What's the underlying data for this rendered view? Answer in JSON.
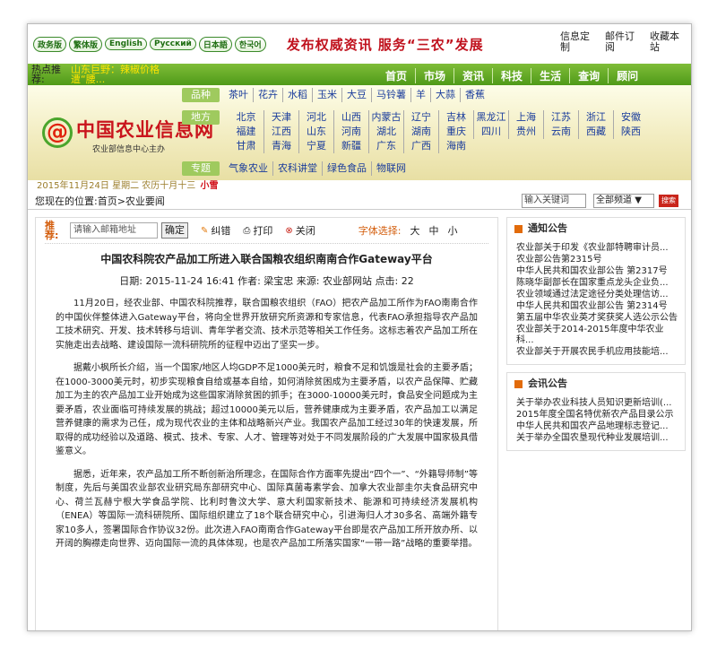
{
  "top": {
    "langs": [
      "政务版",
      "繁体版",
      "English",
      "Русский",
      "日本語",
      "한국어"
    ],
    "slogan": "发布权威资讯    服务“三农”发展",
    "links": [
      "信息定制",
      "邮件订阅",
      "收藏本站"
    ]
  },
  "nav": {
    "ticker_label": "热点推荐:",
    "ticker_text": "山东巨野：辣椒价格遭“腰...",
    "items": [
      "首页",
      "市场",
      "资讯",
      "科技",
      "生活",
      "查询",
      "顾问"
    ]
  },
  "header": {
    "logo_mark": "@",
    "logo_title": "中国农业信息网",
    "logo_sub": "农业部信息中心主办",
    "cats": [
      {
        "label": "品种",
        "items": [
          "茶叶",
          "花卉",
          "水稻",
          "玉米",
          "大豆",
          "马铃薯",
          "羊",
          "大蒜",
          "香蕉"
        ]
      },
      {
        "label": "地方",
        "items": [
          "北京",
          "天津",
          "河北",
          "山西",
          "内蒙古",
          "辽宁",
          "吉林",
          "黑龙江",
          "上海",
          "江苏",
          "浙江",
          "安徽",
          "福建",
          "江西",
          "山东",
          "河南",
          "湖北",
          "湖南",
          "重庆",
          "四川",
          "贵州",
          "云南",
          "西藏",
          "陕西",
          "甘肃",
          "青海",
          "宁夏",
          "新疆",
          "广东",
          "广西",
          "海南"
        ]
      },
      {
        "label": "专题",
        "items": [
          "气象农业",
          "农科讲堂",
          "绿色食品",
          "物联网"
        ]
      }
    ]
  },
  "datebar": {
    "text": "2015年11月24日  星期二  农历十月十三",
    "festival": "小雪"
  },
  "location": {
    "text": "您现在的位置:首页>农业要闻",
    "search_placeholder": "输入关键词",
    "channel": "全部频道",
    "go": "搜索"
  },
  "article": {
    "recommend_label": "推荐:",
    "email_placeholder": "请输入邮箱地址",
    "confirm": "确定",
    "tools": [
      "纠错",
      "打印",
      "关闭"
    ],
    "font_label": "字体选择:",
    "font_sizes": [
      "大",
      "中",
      "小"
    ],
    "title": "中国农科院农产品加工所进入联合国粮农组织南南合作Gateway平台",
    "meta": "日期: 2015-11-24 16:41  作者: 梁宝忠  来源: 农业部网站  点击: 22",
    "paragraphs": [
      "11月20日，经农业部、中国农科院推荐，联合国粮农组织（FAO）把农产品加工所作为FAO南南合作的中国伙伴整体进入Gateway平台，将向全世界开放研究所资源和专家信息，代表FAO承担指导农产品加工技术研究、开发、技术转移与培训、青年学者交流、技术示范等相关工作任务。这标志着农产品加工所在实施走出去战略、建设国际一流科研院所的征程中迈出了坚实一步。",
      "据戴小枫所长介绍，当一个国家/地区人均GDP不足1000美元时，粮食不足和饥饿是社会的主要矛盾；在1000-3000美元时，初步实现粮食自给或基本自给，如何消除贫困成为主要矛盾，以农产品保障、贮藏加工为主的农产品加工业开始成为这些国家消除贫困的抓手；在3000-10000美元时，食品安全问题成为主要矛盾，农业面临可持续发展的挑战；超过10000美元以后，营养健康成为主要矛盾，农产品加工以满足营养健康的需求为己任，成为现代农业的主体和战略新兴产业。我国农产品加工经过30年的快速发展，所取得的成功经验以及道路、模式、技术、专家、人才、管理等对处于不同发展阶段的广大发展中国家极具借鉴意义。",
      "据悉，近年来，农产品加工所不断创新治所理念，在国际合作方面率先提出“四个一”、“外籍导师制”等制度，先后与美国农业部农业研究局东部研究中心、国际真菌毒素学会、加拿大农业部圭尔夫食品研究中心、荷兰瓦赫宁根大学食品学院、比利时鲁汶大学、意大利国家新技术、能源和可持续经济发展机构（ENEA）等国际一流科研院所、国际组织建立了18个联合研究中心，引进海归人才30多名、高端外籍专家10多人，签署国际合作协议32份。此次进入FAO南南合作Gateway平台即是农产品加工所开放办所、以开阔的胸襟走向世界、迈向国际一流的具体体现，也是农产品加工所落实国家“一带一路”战略的重要举措。"
    ]
  },
  "side": {
    "notice": {
      "title": "通知公告",
      "items": [
        "农业部关于印发《农业部特聘审计员...",
        "农业部公告第2315号",
        "中华人民共和国农业部公告 第2317号",
        "陈晓华副部长在国家重点龙头企业负...",
        "农业领域通过法定途径分类处理信访...",
        "中华人民共和国农业部公告 第2314号",
        "第五届中华农业英才奖获奖人选公示公告",
        "农业部关于2014-2015年度中华农业科...",
        "农业部关于开展农民手机应用技能培..."
      ]
    },
    "meeting": {
      "title": "会讯公告",
      "items": [
        "关于举办农业科技人员知识更新培训(...",
        "2015年度全国名特优新农产品目录公示",
        "中华人民共和国农产品地理标志登记...",
        "关于举办全国农垦现代种业发展培训..."
      ]
    }
  }
}
